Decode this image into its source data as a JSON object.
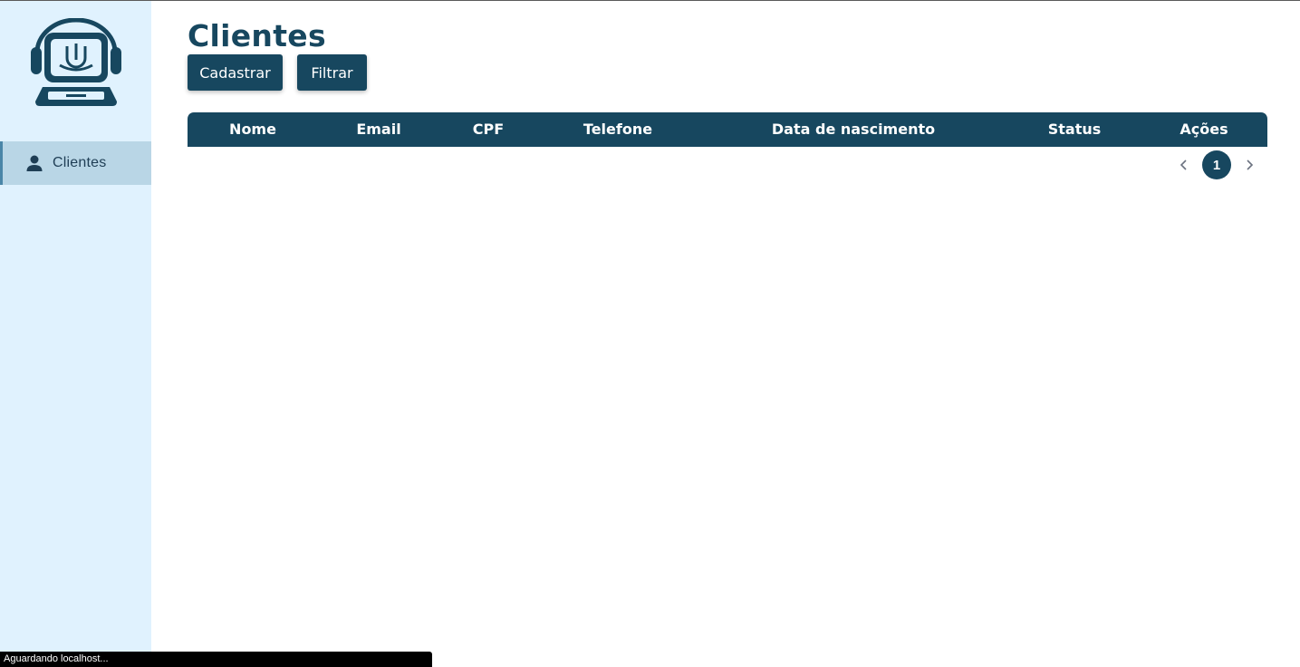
{
  "sidebar": {
    "logo_icon": "support-agent-laptop-icon",
    "items": [
      {
        "label": "Clientes",
        "icon": "user-icon",
        "active": true
      }
    ]
  },
  "page": {
    "title": "Clientes"
  },
  "toolbar": {
    "cadastrar_label": "Cadastrar",
    "filtrar_label": "Filtrar"
  },
  "table": {
    "columns": [
      "Nome",
      "Email",
      "CPF",
      "Telefone",
      "Data de nascimento",
      "Status",
      "Ações"
    ],
    "rows": []
  },
  "pagination": {
    "current_page": "1",
    "prev_icon": "chevron-left-icon",
    "next_icon": "chevron-right-icon"
  },
  "status_bar": {
    "text": "Aguardando localhost..."
  },
  "colors": {
    "primary": "#17475f",
    "sidebar_bg": "#e0f2fe",
    "nav_active_bg": "#b9d6e6"
  }
}
